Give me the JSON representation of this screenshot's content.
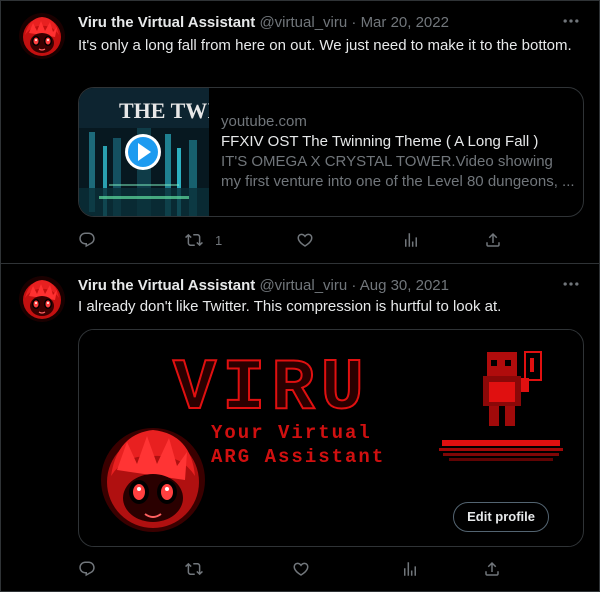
{
  "tweets": [
    {
      "name": "Viru the Virtual Assistant",
      "handle": "@virtual_viru",
      "separator": "·",
      "date": "Mar 20, 2022",
      "text": "It's only a long fall from here on out. We just need to make it to the bottom.",
      "card": {
        "thumb_text": "THE TWIN",
        "domain": "youtube.com",
        "title": "FFXIV OST The Twinning Theme ( A Long Fall )",
        "description": "IT'S OMEGA X CRYSTAL TOWER.Video showing my first venture into one of the Level 80 dungeons, ..."
      },
      "actions": {
        "reply_count": "",
        "retweet_count": "1",
        "like_count": "",
        "views_count": ""
      }
    },
    {
      "name": "Viru the Virtual Assistant",
      "handle": "@virtual_viru",
      "separator": "·",
      "date": "Aug 30, 2021",
      "text": "I already don't like Twitter. This compression is hurtful to look at.",
      "media": {
        "banner_title": "VIRU",
        "banner_subtitle_1": "Your Virtual",
        "banner_subtitle_2": "ARG Assistant",
        "button_label": "Edit profile"
      },
      "actions": {
        "reply_count": "",
        "retweet_count": "",
        "like_count": "",
        "views_count": ""
      }
    }
  ],
  "icons": [
    "more-icon",
    "reply-icon",
    "retweet-icon",
    "like-icon",
    "views-icon",
    "share-icon",
    "play-icon"
  ],
  "colors": {
    "accent_red": "#e01010",
    "muted": "#71767b",
    "border": "#2f3336",
    "text": "#e7e9ea",
    "play_blue": "#1d9bf0"
  }
}
